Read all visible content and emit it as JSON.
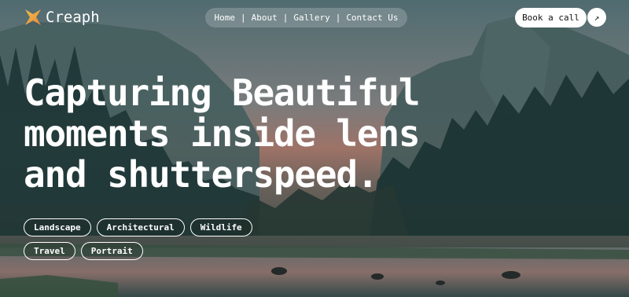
{
  "brand": {
    "name": "Creaph",
    "logo_icon": "star-logo-icon",
    "logo_color": "#f2a33a"
  },
  "nav": {
    "items": [
      {
        "label": "Home"
      },
      {
        "label": "About"
      },
      {
        "label": "Gallery"
      },
      {
        "label": "Contact Us"
      }
    ],
    "separator": "|"
  },
  "cta": {
    "label": "Book a call",
    "arrow_icon": "arrow-up-right-icon",
    "arrow_glyph": "↗"
  },
  "hero": {
    "lines": [
      "Capturing Beautiful",
      "moments inside lens",
      "and shutterspeed."
    ]
  },
  "tags": {
    "row1": [
      "Landscape",
      "Architectural",
      "Wildlife"
    ],
    "row2": [
      "Travel",
      "Portrait"
    ]
  },
  "colors": {
    "text": "#ffffff",
    "button_bg": "#ffffff",
    "button_text": "#111111"
  }
}
